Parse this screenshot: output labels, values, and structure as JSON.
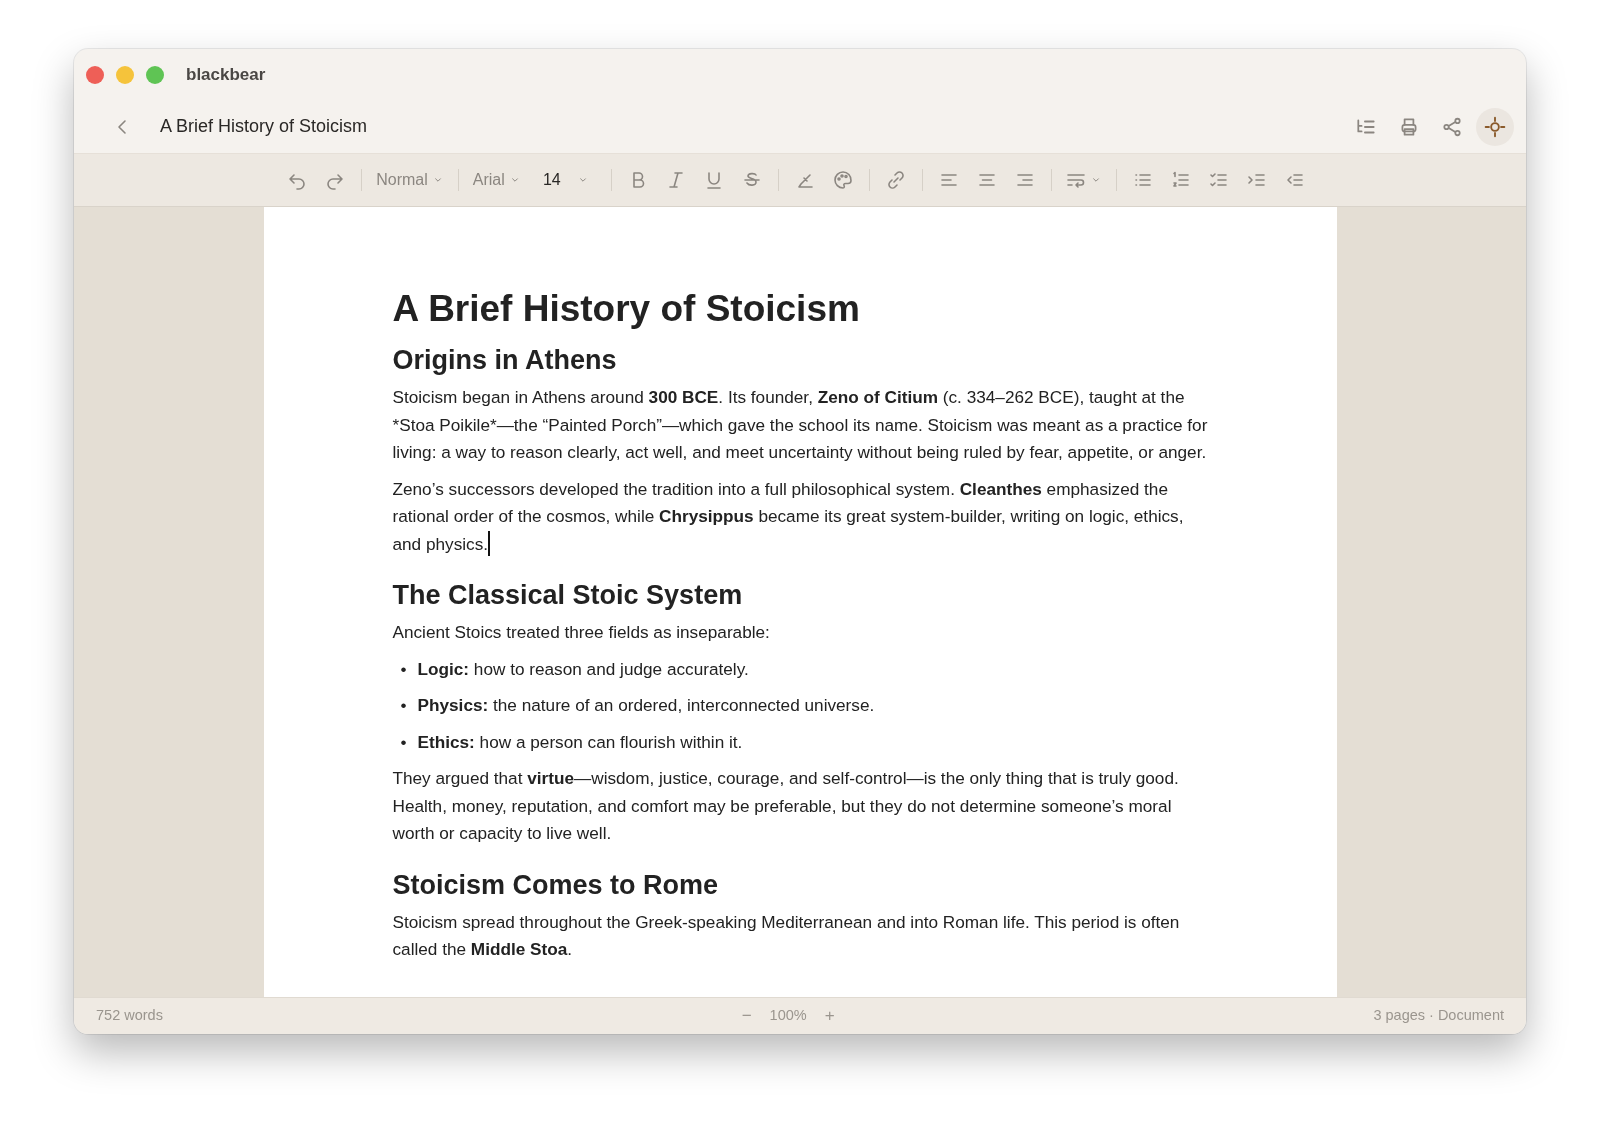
{
  "window": {
    "title": "blackbear"
  },
  "header": {
    "document_title": "A Brief History of Stoicism"
  },
  "toolbar": {
    "style": "Normal",
    "font": "Arial",
    "size": "14"
  },
  "document": [
    {
      "kind": "title",
      "text": "A Brief History of Stoicism"
    },
    {
      "kind": "heading",
      "text": "Origins in Athens"
    },
    {
      "kind": "paragraph",
      "runs": [
        {
          "text": "Stoicism began in Athens around ",
          "bold": false
        },
        {
          "text": "300 BCE",
          "bold": true
        },
        {
          "text": ". Its founder, ",
          "bold": false
        },
        {
          "text": "Zeno of Citium",
          "bold": true
        },
        {
          "text": " (c. 334–262 BCE), taught at the *Stoa Poikile*—the “Painted Porch”—which gave the school its name. Stoicism was meant as a practice for living: a way to reason clearly, act well, and meet uncertainty without being ruled by fear, appetite, or anger.",
          "bold": false
        }
      ]
    },
    {
      "kind": "paragraph",
      "cursor_after": true,
      "runs": [
        {
          "text": "Zeno’s successors developed the tradition into a full philosophical system. ",
          "bold": false
        },
        {
          "text": "Cleanthes",
          "bold": true
        },
        {
          "text": " emphasized the rational order of the cosmos, while ",
          "bold": false
        },
        {
          "text": "Chrysippus",
          "bold": true
        },
        {
          "text": " became its great system-builder, writing on logic, ethics, and physics.",
          "bold": false
        }
      ]
    },
    {
      "kind": "heading",
      "text": "The Classical Stoic System"
    },
    {
      "kind": "paragraph",
      "runs": [
        {
          "text": "Ancient Stoics treated three fields as inseparable:",
          "bold": false
        }
      ]
    },
    {
      "kind": "bullets",
      "items": [
        {
          "marker": "•",
          "runs": [
            {
              "text": "Logic:",
              "bold": true
            },
            {
              "text": " how to reason and judge accurately.",
              "bold": false
            }
          ]
        },
        {
          "marker": "•",
          "runs": [
            {
              "text": "Physics:",
              "bold": true
            },
            {
              "text": " the nature of an ordered, interconnected universe.",
              "bold": false
            }
          ]
        },
        {
          "marker": "•",
          "runs": [
            {
              "text": "Ethics:",
              "bold": true
            },
            {
              "text": " how a person can flourish within it.",
              "bold": false
            }
          ]
        }
      ]
    },
    {
      "kind": "paragraph",
      "runs": [
        {
          "text": "They argued that ",
          "bold": false
        },
        {
          "text": "virtue",
          "bold": true
        },
        {
          "text": "—wisdom, justice, courage, and self-control—is the only thing that is truly good. Health, money, reputation, and comfort may be preferable, but they do not determine someone’s moral worth or capacity to live well.",
          "bold": false
        }
      ]
    },
    {
      "kind": "heading",
      "text": "Stoicism Comes to Rome"
    },
    {
      "kind": "paragraph",
      "runs": [
        {
          "text": "Stoicism spread throughout the Greek-speaking Mediterranean and into Roman life. This period is often called the ",
          "bold": false
        },
        {
          "text": "Middle Stoa",
          "bold": true
        },
        {
          "text": ".",
          "bold": false
        }
      ]
    }
  ],
  "status_bar": {
    "word_count": "752 words",
    "zoom_out": "−",
    "zoom": "100%",
    "zoom_in": "+",
    "info": "3 pages · Document"
  }
}
